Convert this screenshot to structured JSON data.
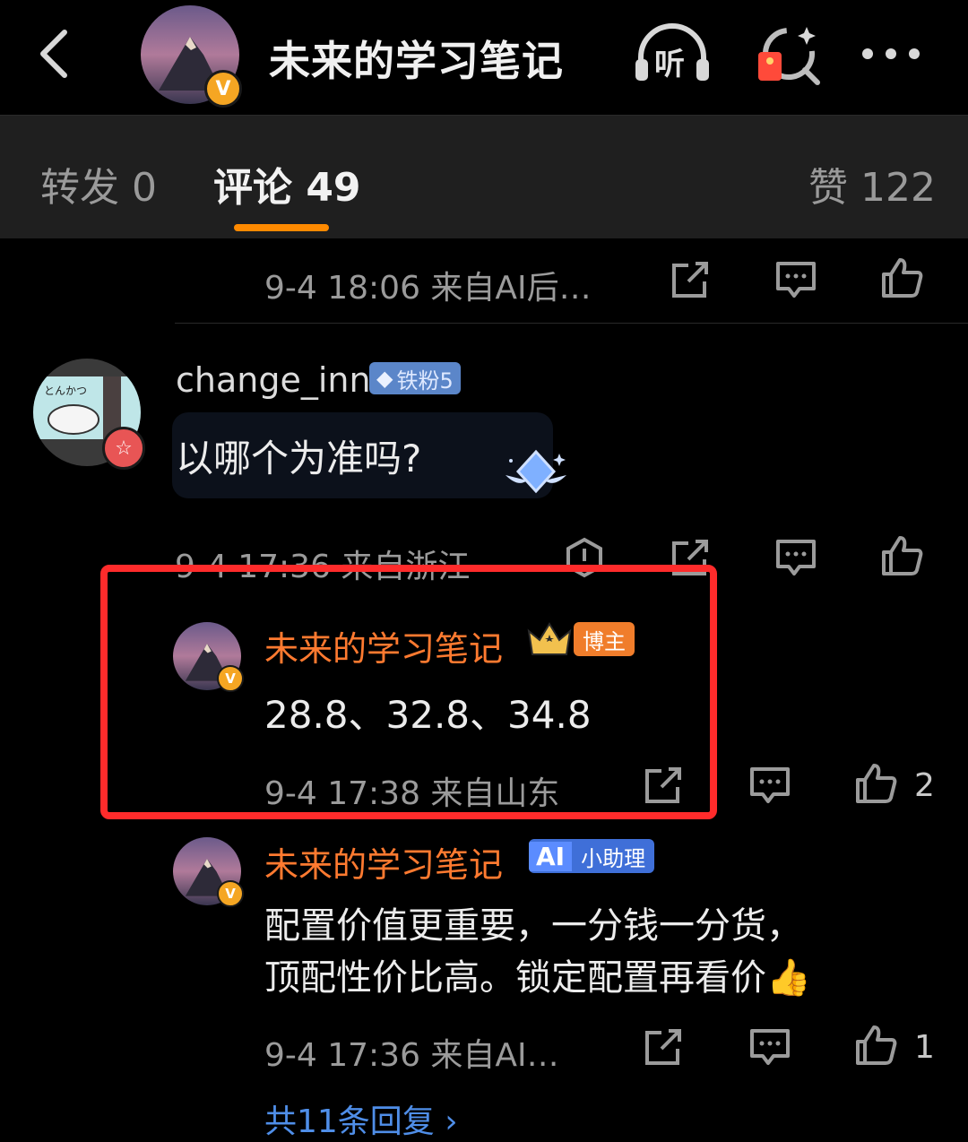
{
  "header": {
    "title": "未来的学习笔记",
    "listen_label": "听",
    "colors": {
      "accent": "#ff8a00",
      "verified": "#f5a623"
    }
  },
  "tabs": [
    {
      "label": "转发 0"
    },
    {
      "label": "评论 49"
    },
    {
      "label": "赞 122"
    }
  ],
  "comments": {
    "prev_meta": "9-4 18:06  来自AI后…",
    "c1": {
      "user": "change_inn",
      "badge": "铁粉5",
      "text": "以哪个为准吗?",
      "meta": "9-4 17:36  来自浙江"
    },
    "r1": {
      "user": "未来的学习笔记",
      "badge": "博主",
      "text": "28.8、32.8、34.8",
      "meta": "9-4 17:38  来自山东",
      "likes": "2"
    },
    "r2": {
      "user": "未来的学习笔记",
      "badge_ai": "AI",
      "badge": "小助理",
      "text_line1": "配置价值更重要，一分钱一分货，",
      "text_line2": "顶配性价比高。锁定配置再看价👍",
      "meta": "9-4 17:36  来自AI…",
      "likes": "1"
    },
    "more_replies": "共11条回复 ›"
  }
}
